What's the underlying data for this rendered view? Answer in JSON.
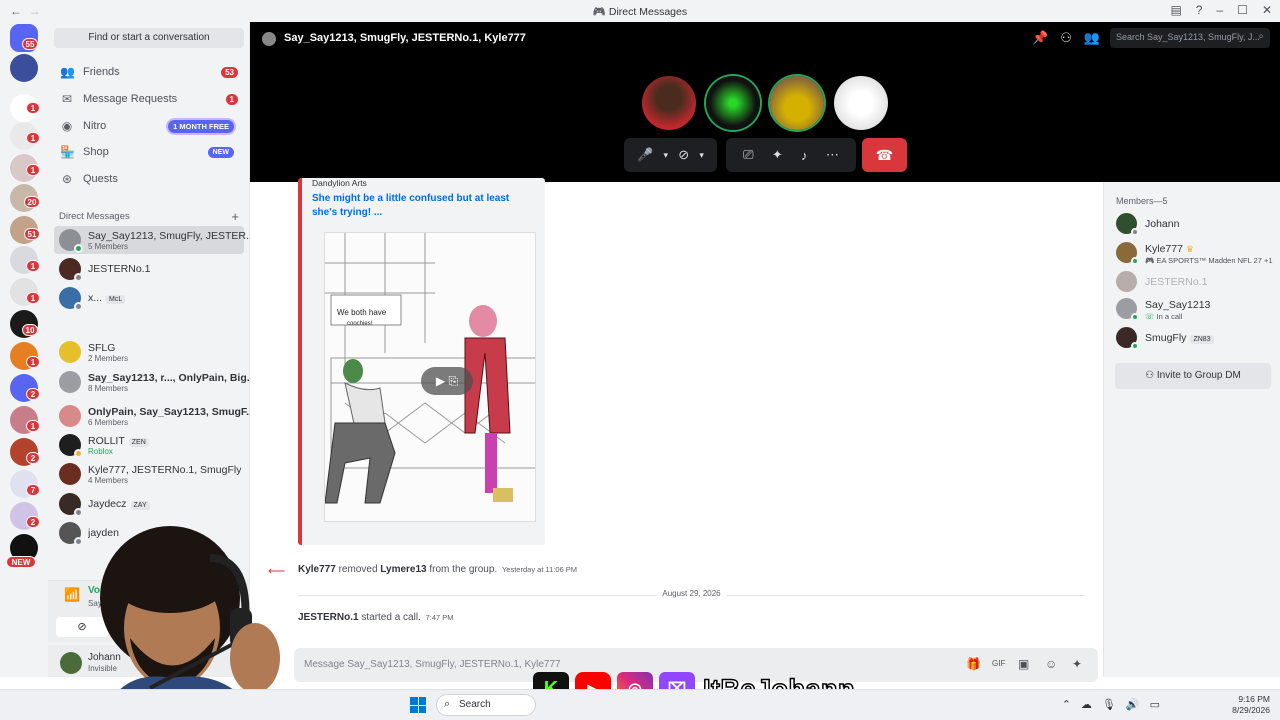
{
  "window": {
    "title": "Direct Messages"
  },
  "rail": {
    "home_badge": "55",
    "badges": [
      "1",
      "1",
      "1",
      "20",
      "51",
      "1",
      "1",
      "10",
      "1",
      "2",
      "1",
      "2",
      "7",
      "2"
    ],
    "new_label": "NEW"
  },
  "sidebar": {
    "find_placeholder": "Find or start a conversation",
    "nav": [
      {
        "label": "Friends",
        "icon": "friends-icon",
        "badge": "53"
      },
      {
        "label": "Message Requests",
        "icon": "mail-icon",
        "badge": "1"
      },
      {
        "label": "Nitro",
        "icon": "nitro-icon",
        "pill": "1 MONTH FREE"
      },
      {
        "label": "Shop",
        "icon": "shop-icon",
        "pill": "NEW"
      },
      {
        "label": "Quests",
        "icon": "quests-icon"
      }
    ],
    "dm_header": "Direct Messages",
    "dms": [
      {
        "name": "Say_Say1213, SmugFly, JESTER...",
        "sub": "5 Members"
      },
      {
        "name": "JESTERNo.1",
        "sub": ""
      },
      {
        "name": "x...",
        "sub": "",
        "tag": "McL"
      },
      {
        "name": "SFLG",
        "sub": "2 Members"
      },
      {
        "name": "Say_Say1213, r..., OnlyPain, Big...",
        "sub": "8 Members"
      },
      {
        "name": "OnlyPain, Say_Say1213, SmugF...",
        "sub": "6 Members"
      },
      {
        "name": "ROLLIT",
        "sub": "Roblox",
        "tag": "ZEN"
      },
      {
        "name": "Kyle777, JESTERNo.1, SmugFly",
        "sub": "4 Members"
      },
      {
        "name": "Jaydecz",
        "sub": "",
        "tag": "ZAY"
      },
      {
        "name": "jayden",
        "sub": ""
      }
    ],
    "voice": {
      "label": "Voice Conne...",
      "sub": "Say_Say1213, S..."
    },
    "user": {
      "name": "Johann",
      "status": "Invisible"
    }
  },
  "call": {
    "channel_name": "Say_Say1213, SmugFly, JESTERNo.1, Kyle777",
    "search_placeholder": "Search Say_Say1213, SmugFly, J..."
  },
  "chat": {
    "embed": {
      "provider": "Dandylion Arts",
      "title": "She might be a little confused but at least she's trying! ...",
      "art_text_line1": "We both have",
      "art_text_line2": "coochies!"
    },
    "removed": {
      "actor": "Kyle777",
      "action": "removed",
      "target": "Lymere13",
      "suffix": "from the group.",
      "time": "Yesterday at 11:06 PM"
    },
    "date_divider": "August 29, 2026",
    "call_msg": {
      "actor": "JESTERNo.1",
      "action": "started a call.",
      "time": "7:47 PM"
    },
    "composer_placeholder": "Message Say_Say1213, SmugFly, JESTERNo.1, Kyle777"
  },
  "members": {
    "header": "Members—5",
    "list": [
      {
        "name": "Johann",
        "status": ""
      },
      {
        "name": "Kyle777",
        "status": "EA SPORTS™ Madden NFL 27 +1"
      },
      {
        "name": "JESTERNo.1",
        "status": ""
      },
      {
        "name": "Say_Say1213",
        "status": "In a call"
      },
      {
        "name": "SmugFly",
        "status": "",
        "tag": "ZN83"
      }
    ],
    "invite_label": "Invite to Group DM"
  },
  "taskbar": {
    "search": "Search",
    "time": "9:16 PM",
    "date": "8/29/2026"
  },
  "stream_overlay": {
    "handle": "ItBeJohann"
  },
  "colors": {
    "accent": "#5865f2",
    "danger": "#da373c",
    "online": "#23a55a",
    "link": "#006ce7"
  }
}
